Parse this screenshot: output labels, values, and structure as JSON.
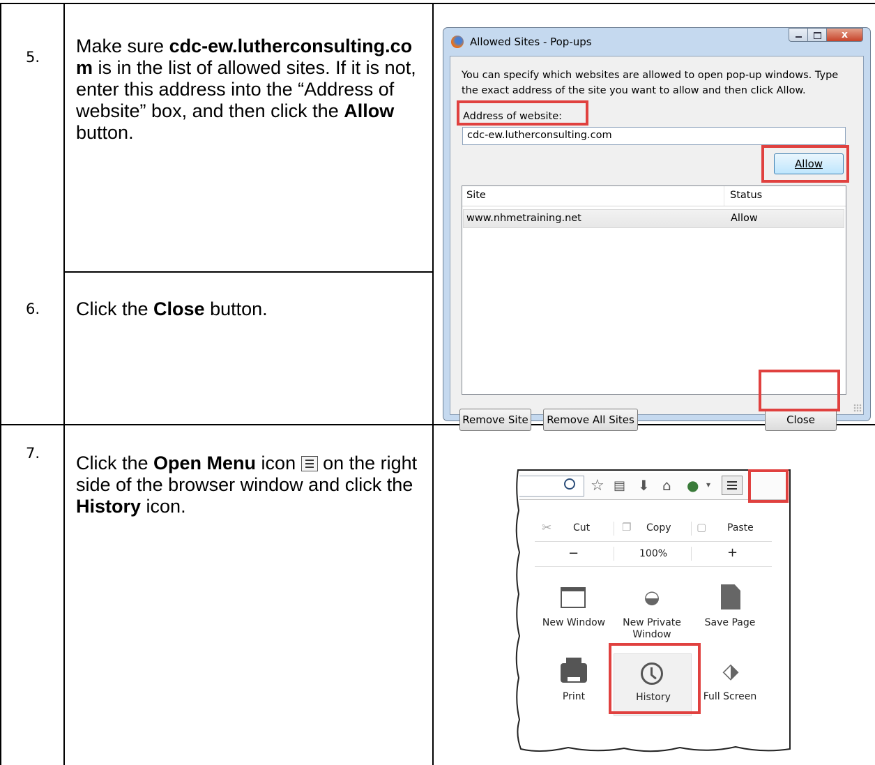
{
  "steps": [
    {
      "number": "5.",
      "text_parts": [
        "Make sure ",
        "cdc-ew.lutherconsulting.com",
        " is in the list of allowed sites. If it is not, enter this address into the “Address of website” box, and then click the ",
        "Allow",
        " button."
      ]
    },
    {
      "number": "6.",
      "text_parts": [
        "Click the ",
        "Close",
        " button."
      ]
    },
    {
      "number": "7.",
      "text_parts": [
        "Click the ",
        "Open Menu",
        " icon ",
        " on the right side of the browser window and click the ",
        "History",
        " icon."
      ]
    }
  ],
  "dialog": {
    "title": "Allowed Sites - Pop-ups",
    "description": "You can specify which websites are allowed to open pop-up windows. Type the exact address of the site you want to allow and then click Allow.",
    "address_label": "Address of website:",
    "address_value": "cdc-ew.lutherconsulting.com",
    "allow_label": "Allow",
    "columns": [
      "Site",
      "Status"
    ],
    "rows": [
      {
        "site": "www.nhmetraining.net",
        "status": "Allow"
      }
    ],
    "remove_site_label": "Remove Site",
    "remove_all_label": "Remove All Sites",
    "close_label": "Close",
    "close_glyph": "x"
  },
  "firefox_menu": {
    "edit_row": [
      "Cut",
      "Copy",
      "Paste"
    ],
    "zoom": {
      "minus": "−",
      "level": "100%",
      "plus": "+"
    },
    "items": [
      {
        "label": "New Window",
        "icon": "window-icon"
      },
      {
        "label": "New Private Window",
        "icon": "mask-icon"
      },
      {
        "label": "Save Page",
        "icon": "page-icon"
      },
      {
        "label": "Print",
        "icon": "printer-icon"
      },
      {
        "label": "History",
        "icon": "clock-icon"
      },
      {
        "label": "Full Screen",
        "icon": "fullscreen-icon"
      }
    ]
  },
  "colors": {
    "highlight": "#e0413f",
    "dialog_frame": "#c5d9ef"
  }
}
